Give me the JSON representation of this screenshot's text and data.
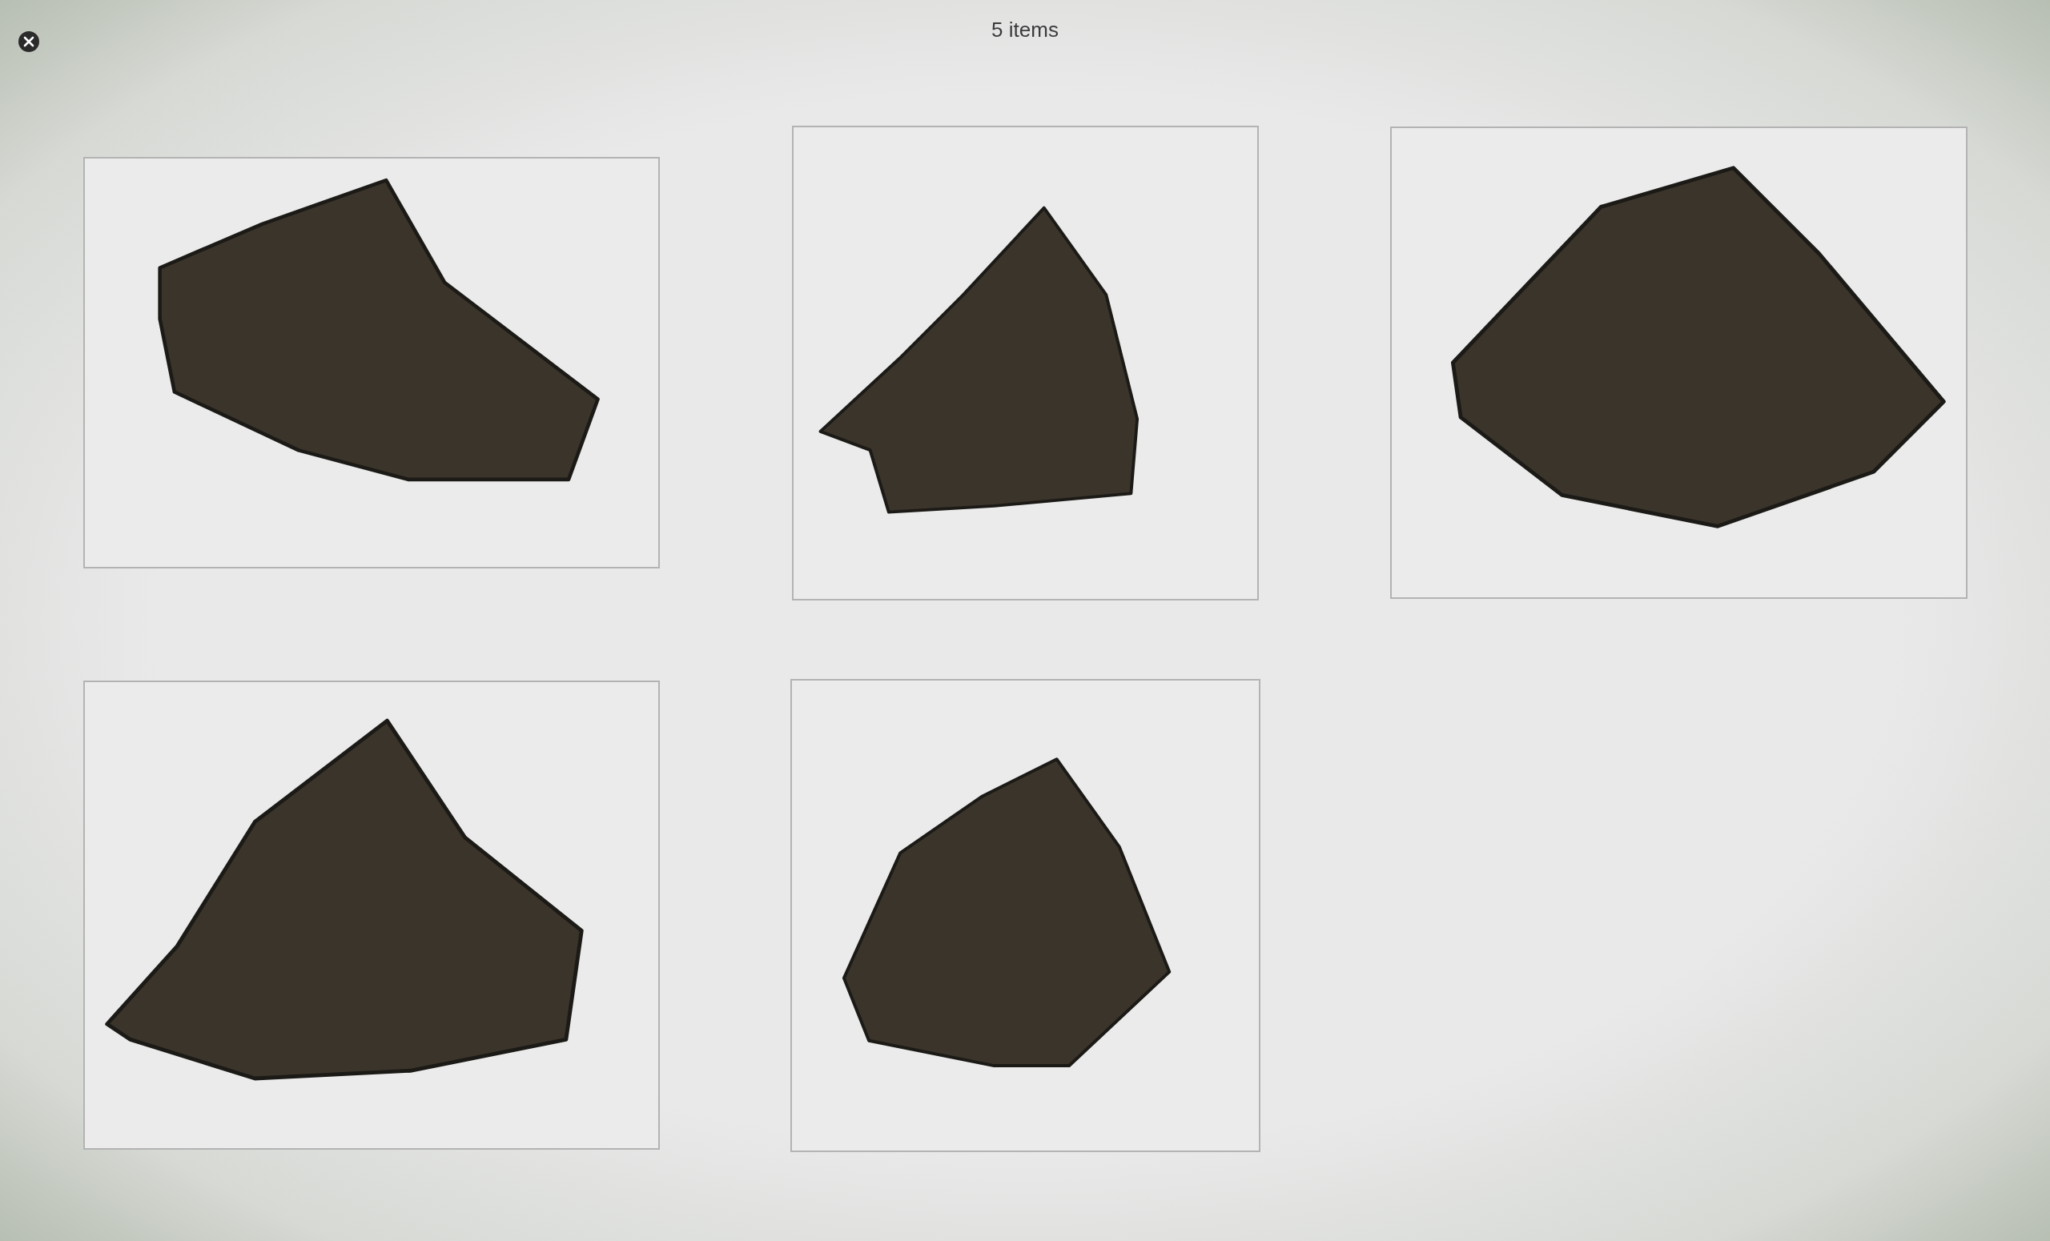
{
  "window": {
    "title": "5 items"
  },
  "items": [
    {
      "kind": "image"
    },
    {
      "kind": "image"
    },
    {
      "kind": "image"
    },
    {
      "kind": "image"
    },
    {
      "kind": "image"
    }
  ]
}
